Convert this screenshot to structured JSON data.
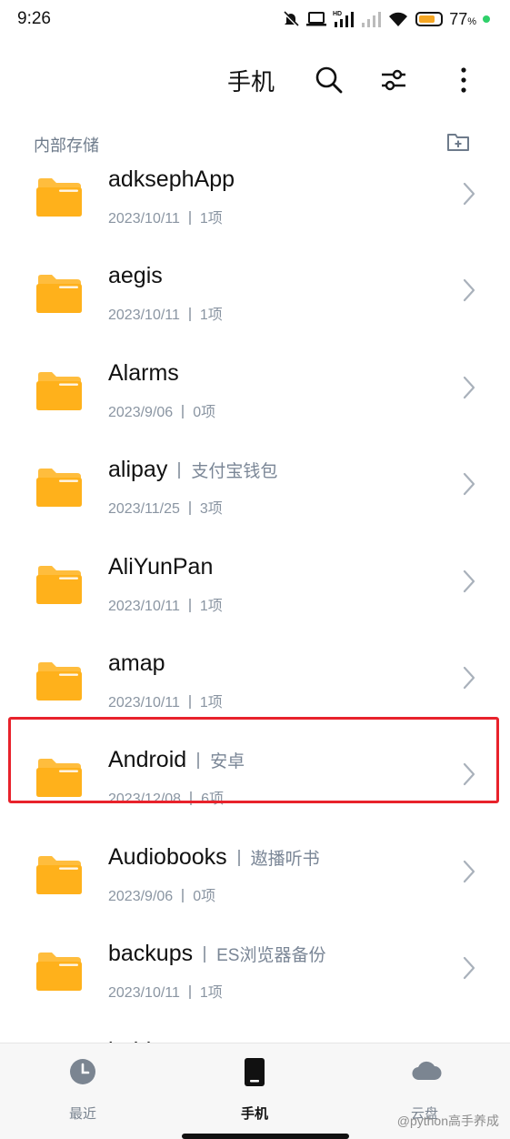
{
  "status_bar": {
    "time": "9:26",
    "battery_percent": "77",
    "battery_unit": "%",
    "battery_level": 0.77,
    "hd_label": "HD",
    "icons": [
      "mute-icon",
      "laptop-icon",
      "hd-signal-icon",
      "signal-icon",
      "wifi-icon",
      "battery-icon",
      "dot-indicator"
    ]
  },
  "header": {
    "title": "手机",
    "icons": [
      "search-icon",
      "filter-icon",
      "more-icon"
    ]
  },
  "location": {
    "label": "内部存储",
    "icon": "new-folder-icon"
  },
  "files": [
    {
      "name": "adksephApp",
      "alias": "",
      "date": "2023/10/11",
      "count": "1项"
    },
    {
      "name": "aegis",
      "alias": "",
      "date": "2023/10/11",
      "count": "1项"
    },
    {
      "name": "Alarms",
      "alias": "",
      "date": "2023/9/06",
      "count": "0项"
    },
    {
      "name": "alipay",
      "alias": "支付宝钱包",
      "date": "2023/11/25",
      "count": "3项"
    },
    {
      "name": "AliYunPan",
      "alias": "",
      "date": "2023/10/11",
      "count": "1项"
    },
    {
      "name": "amap",
      "alias": "",
      "date": "2023/10/11",
      "count": "1项"
    },
    {
      "name": "Android",
      "alias": "安卓",
      "date": "2023/12/08",
      "count": "6项"
    },
    {
      "name": "Audiobooks",
      "alias": "遨播听书",
      "date": "2023/9/06",
      "count": "0项"
    },
    {
      "name": "backups",
      "alias": "ES浏览器备份",
      "date": "2023/10/11",
      "count": "1项"
    },
    {
      "name": "baidu",
      "alias": "百度",
      "date": "",
      "count": ""
    }
  ],
  "bottom_nav": [
    {
      "label": "最近",
      "icon": "clock-icon",
      "active": false
    },
    {
      "label": "手机",
      "icon": "phone-icon",
      "active": true
    },
    {
      "label": "云盘",
      "icon": "cloud-icon",
      "active": false
    }
  ],
  "watermark": "@python高手养成",
  "colors": {
    "folder": "#FFB11B",
    "highlight": "#E8222B",
    "secondary_text": "#8A95A2",
    "battery": "#F5A623",
    "status_dot": "#2FD06A"
  }
}
